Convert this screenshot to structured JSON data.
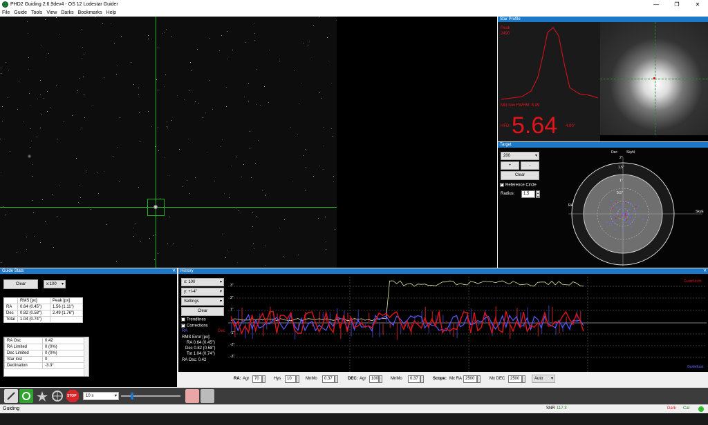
{
  "window": {
    "title": "PHD2 Guiding 2.6.9dev4 - OS 12 Lodestar Guider",
    "min": "—",
    "max": "❐",
    "close": "✕"
  },
  "menu": [
    "File",
    "Guide",
    "Tools",
    "View",
    "Darks",
    "Bookmarks",
    "Help"
  ],
  "star_profile": {
    "header": "Star Profile",
    "peak_label": "Peak",
    "peak_value": "2490",
    "fwhm": "Mid row FWHM: 8.49",
    "hfd_label": "HFD:",
    "hfd_value": "5.64",
    "hfd_arcsec": "4.00\""
  },
  "target": {
    "header": "Target",
    "zoom_value": "200",
    "plus": "+",
    "minus": "-",
    "clear": "Clear",
    "reference_circle": "Reference Circle",
    "radius_label": "Radius:",
    "radius_value": "1.5",
    "axis_dec": "Dec",
    "axis_skyn": "SkyN",
    "axis_ra": "RA",
    "axis_skye": "SkyE",
    "ring_labels": [
      "2\"",
      "1.5\"",
      "1\"",
      "0.5\""
    ]
  },
  "guide_stats": {
    "header": "Guide Stats",
    "clear": "Clear",
    "scale": "x:100",
    "cols": [
      "",
      "RMS [px]",
      "Peak [px]"
    ],
    "rows": [
      [
        "RA",
        "0.64 (0.45\")",
        "1.56 (1.11\")"
      ],
      [
        "Dec",
        "0.82 (0.58\")",
        "2.49 (1.76\")"
      ],
      [
        "Total",
        "1.04 (0.74\")",
        ""
      ]
    ],
    "info": [
      [
        "RA Osc",
        "0.42"
      ],
      [
        "RA Limited",
        "0 (0%)"
      ],
      [
        "Dec Limited",
        "0 (0%)"
      ],
      [
        "Star lost",
        "0"
      ],
      [
        "Declination",
        "-3.3°"
      ]
    ]
  },
  "history": {
    "header": "History",
    "x_scale": "x: 100",
    "y_scale": "y: +/-4\"",
    "settings": "Settings",
    "clear": "Clear",
    "trendlines": "Trendlines",
    "corrections": "Corrections",
    "ra": "RA",
    "dec": "Dec",
    "rms_title": "RMS Error [px]:",
    "rms_ra": "RA 0.64 (0.45\")",
    "rms_dec": "Dec 0.82 (0.58\")",
    "rms_tot": "Tot 1.04 (0.74\")",
    "ra_osc": "RA Osc: 0.42",
    "guide_north": "GuideNorth",
    "guide_east": "GuideEast",
    "y_labels": [
      "3\"",
      "2\"",
      "1\"",
      "-1\"",
      "-2\"",
      "-3\""
    ],
    "ra_color": "#5a5aff",
    "dec_color": "#e0141a",
    "snr_color": "#e6e6a0"
  },
  "params": {
    "ra_label": "RA:",
    "agr_label": "Agr",
    "agr_value": "70",
    "hys_label": "Hys",
    "hys_value": "10",
    "mnmo_label": "MnMo",
    "mnmo_value": "0.37",
    "dec_label": "DEC:",
    "dec_agr_label": "Agr",
    "dec_agr_value": "100",
    "dec_mnmo_label": "MnMo",
    "dec_mnmo_value": "0.37",
    "scope_label": "Scope:",
    "mxra_label": "Mx RA",
    "mxra_value": "2500",
    "mxdec_label": "Mx DEC",
    "mxdec_value": "2500",
    "mode": "Auto"
  },
  "controls": {
    "exposure": "10 s",
    "stop": "STOP"
  },
  "status": {
    "text": "Guiding",
    "snr_label": "SNR",
    "snr_value": "117.3",
    "dark": "Dark",
    "cal": "Cal"
  }
}
